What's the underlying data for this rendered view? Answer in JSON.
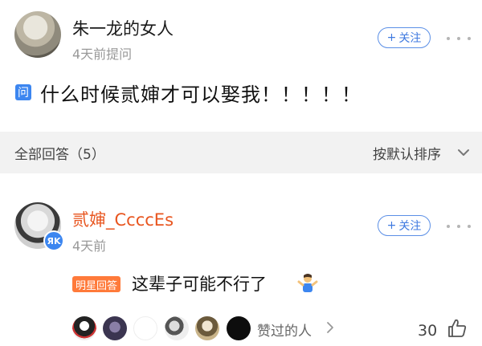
{
  "question": {
    "asker_name": "朱一龙的女人",
    "asker_time": "4天前提问",
    "follow_label": "关注",
    "badge": "问",
    "text": "什么时候贰婶才可以娶我！！！！！"
  },
  "answers_bar": {
    "count_label": "全部回答（5）",
    "sort_label": "按默认排序"
  },
  "answer": {
    "author": "贰婶_CccсEs",
    "verified_mark": "ЯK",
    "time": "4天前",
    "follow_label": "关注",
    "badge": "明星回答",
    "text": "这辈子可能不行了",
    "emoji_icon": "person-shrugging-icon",
    "liked_by_label": "赞过的人",
    "like_count": "30"
  },
  "colors": {
    "accent_blue": "#3c86f0",
    "author_orange": "#e8551f",
    "star_badge": "#ff7a3a",
    "bar_gray": "#f2f2f2"
  }
}
